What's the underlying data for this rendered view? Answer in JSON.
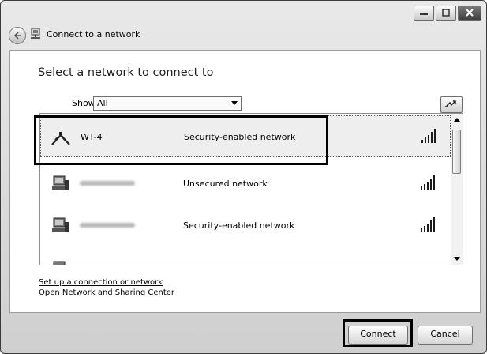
{
  "window": {
    "title": "Connect to a network",
    "controls": [
      "minimize",
      "maximize",
      "close"
    ]
  },
  "main": {
    "heading": "Select a network to connect to",
    "show": {
      "label": "Show",
      "selected": "All"
    },
    "networks": [
      {
        "ssid": "WT-4",
        "security": "Security-enabled network",
        "icon": "wireless-icon",
        "selected": true
      },
      {
        "ssid": "",
        "security": "Unsecured network",
        "icon": "computer-network-icon",
        "selected": false
      },
      {
        "ssid": "",
        "security": "Security-enabled network",
        "icon": "computer-network-icon",
        "selected": false
      }
    ],
    "links": {
      "setup": "Set up a connection or network",
      "sharing": "Open Network and Sharing Center"
    }
  },
  "footer": {
    "connect_label": "Connect",
    "cancel_label": "Cancel"
  }
}
